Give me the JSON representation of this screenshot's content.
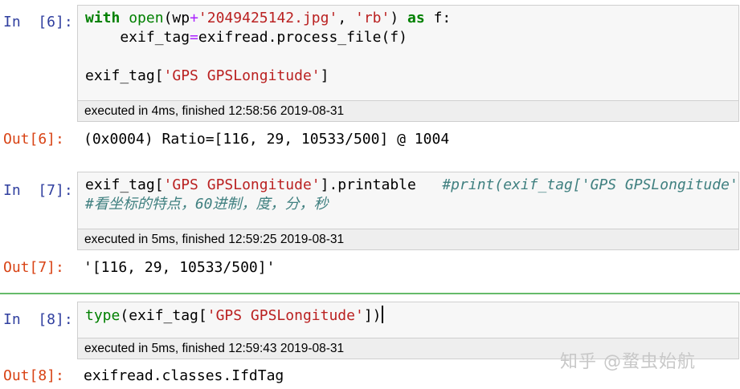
{
  "cells": [
    {
      "in_prompt": "In  [6]:",
      "code": {
        "l1_kw_with": "with",
        "l1_fn_open": "open",
        "l1_a": "(wp",
        "l1_plus": "+",
        "l1_str_file": "'2049425142.jpg'",
        "l1_comma": ", ",
        "l1_str_mode": "'rb'",
        "l1_b": ") ",
        "l1_kw_as": "as",
        "l1_c": " f:",
        "l2_a": "    exif_tag",
        "l2_eq": "=",
        "l2_b": "exifread.process_file(f)",
        "l4_a": "exif_tag[",
        "l4_str": "'GPS GPSLongitude'",
        "l4_b": "]"
      },
      "exec": "executed in 4ms, finished 12:58:56 2019-08-31",
      "out_prompt": "Out[6]:",
      "output": "(0x0004) Ratio=[116, 29, 10533/500] @ 1004"
    },
    {
      "in_prompt": "In  [7]:",
      "code": {
        "l1_a": "exif_tag[",
        "l1_str": "'GPS GPSLongitude'",
        "l1_b": "].printable   ",
        "l1_comment": "#print(exif_tag['GPS GPSLongitude'])",
        "l2_comment": "#看坐标的特点，60进制，度，分，秒"
      },
      "exec": "executed in 5ms, finished 12:59:25 2019-08-31",
      "out_prompt": "Out[7]:",
      "output": "'[116, 29, 10533/500]'"
    },
    {
      "in_prompt": "In  [8]:",
      "code": {
        "l1_fn_type": "type",
        "l1_a": "(exif_tag[",
        "l1_str": "'GPS GPSLongitude'",
        "l1_b": "])"
      },
      "exec": "executed in 5ms, finished 12:59:43 2019-08-31",
      "out_prompt": "Out[8]:",
      "output": "exifread.classes.IfdTag"
    }
  ],
  "watermark": "知乎 @蝥虫始航",
  "colors": {
    "in_prompt": "#303f9f",
    "out_prompt": "#d84315",
    "keyword": "#008000",
    "string": "#ba2121",
    "operator": "#aa22ff",
    "comment": "#408080",
    "selected_cell_bar": "#66bb6a"
  }
}
